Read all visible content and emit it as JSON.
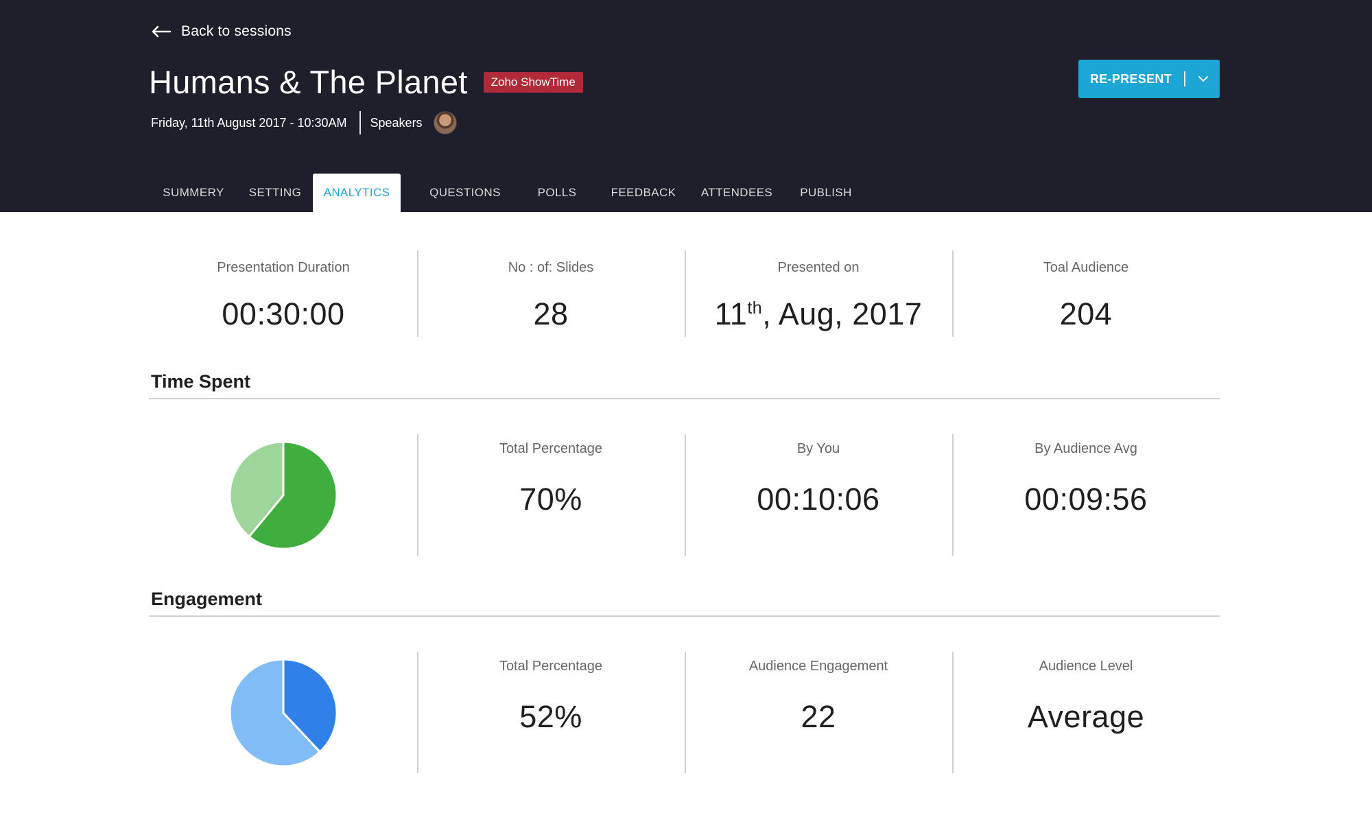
{
  "header": {
    "back_label": "Back to sessions",
    "title": "Humans & The Planet",
    "badge": "Zoho ShowTime",
    "datetime": "Friday, 11th August 2017 - 10:30AM",
    "speakers_label": "Speakers",
    "represent_label": "RE-PRESENT"
  },
  "tabs": [
    {
      "label": "SUMMERY",
      "active": false
    },
    {
      "label": "SETTING",
      "active": false
    },
    {
      "label": "ANALYTICS",
      "active": true
    },
    {
      "label": "QUESTIONS",
      "active": false
    },
    {
      "label": "POLLS",
      "active": false
    },
    {
      "label": "FEEDBACK",
      "active": false
    },
    {
      "label": "ATTENDEES",
      "active": false
    },
    {
      "label": "PUBLISH",
      "active": false
    }
  ],
  "overview": [
    {
      "label": "Presentation Duration",
      "value": "00:30:00"
    },
    {
      "label": "No : of: Slides",
      "value": "28"
    },
    {
      "label": "Presented on",
      "value_day": "11",
      "value_sup": "th",
      "value_rest": ", Aug, 2017"
    },
    {
      "label": "Toal Audience",
      "value": "204"
    }
  ],
  "time_spent": {
    "title": "Time Spent",
    "pie_percent": 61,
    "colors": {
      "filled": "#3fae3f",
      "rest": "#9dd59a"
    },
    "stats": [
      {
        "label": "Total Percentage",
        "value": "70%"
      },
      {
        "label": "By You",
        "value": "00:10:06"
      },
      {
        "label": "By Audience Avg",
        "value": "00:09:56"
      }
    ]
  },
  "engagement": {
    "title": "Engagement",
    "pie_percent": 38,
    "colors": {
      "filled": "#2f80e8",
      "rest": "#80bdf7"
    },
    "stats": [
      {
        "label": "Total Percentage",
        "value": "52%"
      },
      {
        "label": "Audience Engagement",
        "value": "22"
      },
      {
        "label": "Audience Level",
        "value": "Average"
      }
    ]
  },
  "colors": {
    "header_bg": "#1f1f2b",
    "accent": "#1ba6d6",
    "badge": "#b02a37"
  }
}
